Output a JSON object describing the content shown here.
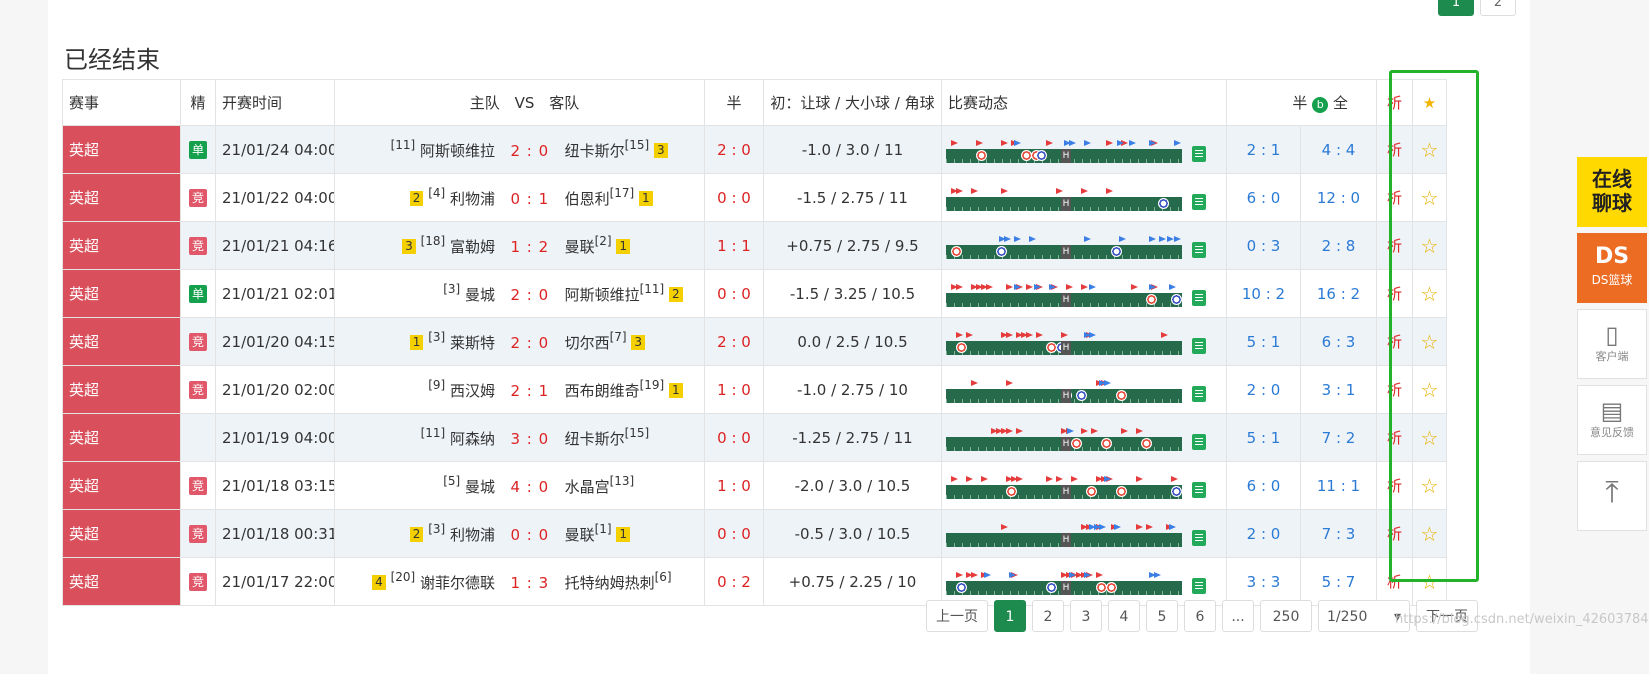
{
  "top_pager": [
    "1",
    "2"
  ],
  "section_title": "已经结束",
  "headers": {
    "league": "赛事",
    "jing": "精",
    "time": "开赛时间",
    "home": "主队",
    "vs": "VS",
    "away": "客队",
    "half": "半",
    "odds": "初：让球 / 大小球 / 角球",
    "live": "比赛动态",
    "half_full_left": "半",
    "half_full_icon": "b",
    "half_full_right": "全",
    "xi": "析"
  },
  "rows": [
    {
      "league": "英超",
      "type": "单",
      "time": "21/01/24 04:00",
      "home_yc": "",
      "home_rank": "[11]",
      "home": "阿斯顿维拉",
      "score": "2 : 0",
      "away": "纽卡斯尔",
      "away_rank": "[15]",
      "away_yc": "3",
      "half": "2 : 0",
      "odds": "-1.0 / 3.0 / 11",
      "hf_half": "2 : 1",
      "hf_full": "4 : 4",
      "xi": "析"
    },
    {
      "league": "英超",
      "type": "竞",
      "time": "21/01/22 04:00",
      "home_yc": "2",
      "home_rank": "[4]",
      "home": "利物浦",
      "score": "0 : 1",
      "away": "伯恩利",
      "away_rank": "[17]",
      "away_yc": "1",
      "half": "0 : 0",
      "odds": "-1.5 / 2.75 / 11",
      "hf_half": "6 : 0",
      "hf_full": "12 : 0",
      "xi": "析"
    },
    {
      "league": "英超",
      "type": "竞",
      "time": "21/01/21 04:16",
      "home_yc": "3",
      "home_rank": "[18]",
      "home": "富勒姆",
      "score": "1 : 2",
      "away": "曼联",
      "away_rank": "[2]",
      "away_yc": "1",
      "half": "1 : 1",
      "odds": "+0.75 / 2.75 / 9.5",
      "hf_half": "0 : 3",
      "hf_full": "2 : 8",
      "xi": "析"
    },
    {
      "league": "英超",
      "type": "单",
      "time": "21/01/21 02:01",
      "home_yc": "",
      "home_rank": "[3]",
      "home": "曼城",
      "score": "2 : 0",
      "away": "阿斯顿维拉",
      "away_rank": "[11]",
      "away_yc": "2",
      "half": "0 : 0",
      "odds": "-1.5 / 3.25 / 10.5",
      "hf_half": "10 : 2",
      "hf_full": "16 : 2",
      "xi": "析"
    },
    {
      "league": "英超",
      "type": "竞",
      "time": "21/01/20 04:15",
      "home_yc": "1",
      "home_rank": "[3]",
      "home": "莱斯特",
      "score": "2 : 0",
      "away": "切尔西",
      "away_rank": "[7]",
      "away_yc": "3",
      "half": "2 : 0",
      "odds": "0.0 / 2.5 / 10.5",
      "hf_half": "5 : 1",
      "hf_full": "6 : 3",
      "xi": "析"
    },
    {
      "league": "英超",
      "type": "竞",
      "time": "21/01/20 02:00",
      "home_yc": "",
      "home_rank": "[9]",
      "home": "西汉姆",
      "score": "2 : 1",
      "away": "西布朗维奇",
      "away_rank": "[19]",
      "away_yc": "1",
      "half": "1 : 0",
      "odds": "-1.0 / 2.75 / 10",
      "hf_half": "2 : 0",
      "hf_full": "3 : 1",
      "xi": "析"
    },
    {
      "league": "英超",
      "type": "",
      "time": "21/01/19 04:00",
      "home_yc": "",
      "home_rank": "[11]",
      "home": "阿森纳",
      "score": "3 : 0",
      "away": "纽卡斯尔",
      "away_rank": "[15]",
      "away_yc": "",
      "half": "0 : 0",
      "odds": "-1.25 / 2.75 / 11",
      "hf_half": "5 : 1",
      "hf_full": "7 : 2",
      "xi": "析"
    },
    {
      "league": "英超",
      "type": "竞",
      "time": "21/01/18 03:15",
      "home_yc": "",
      "home_rank": "[5]",
      "home": "曼城",
      "score": "4 : 0",
      "away": "水晶宫",
      "away_rank": "[13]",
      "away_yc": "",
      "half": "1 : 0",
      "odds": "-2.0 / 3.0 / 10.5",
      "hf_half": "6 : 0",
      "hf_full": "11 : 1",
      "xi": "析"
    },
    {
      "league": "英超",
      "type": "竞",
      "time": "21/01/18 00:31",
      "home_yc": "2",
      "home_rank": "[3]",
      "home": "利物浦",
      "score": "0 : 0",
      "away": "曼联",
      "away_rank": "[1]",
      "away_yc": "1",
      "half": "0 : 0",
      "odds": "-0.5 / 3.0 / 10.5",
      "hf_half": "2 : 0",
      "hf_full": "7 : 3",
      "xi": "析"
    },
    {
      "league": "英超",
      "type": "竞",
      "time": "21/01/17 22:00",
      "home_yc": "4",
      "home_rank": "[20]",
      "home": "谢菲尔德联",
      "score": "1 : 3",
      "away": "托特纳姆热刺",
      "away_rank": "[6]",
      "away_yc": "",
      "half": "0 : 2",
      "odds": "+0.75 / 2.25 / 10",
      "hf_half": "3 : 3",
      "hf_full": "5 : 7",
      "xi": "析"
    }
  ],
  "bottom_pager": {
    "prev": "上一页",
    "pages": [
      "1",
      "2",
      "3",
      "4",
      "5",
      "6",
      "...",
      "250"
    ],
    "select": "1/250",
    "next": "下一页"
  },
  "watermark": "https://blog.csdn.net/weixin_42603784",
  "side": {
    "chat": "在线聊球",
    "ds_logo": "DS",
    "ds_label": "DS篮球",
    "client": "客户端",
    "feedback": "意见反馈"
  }
}
